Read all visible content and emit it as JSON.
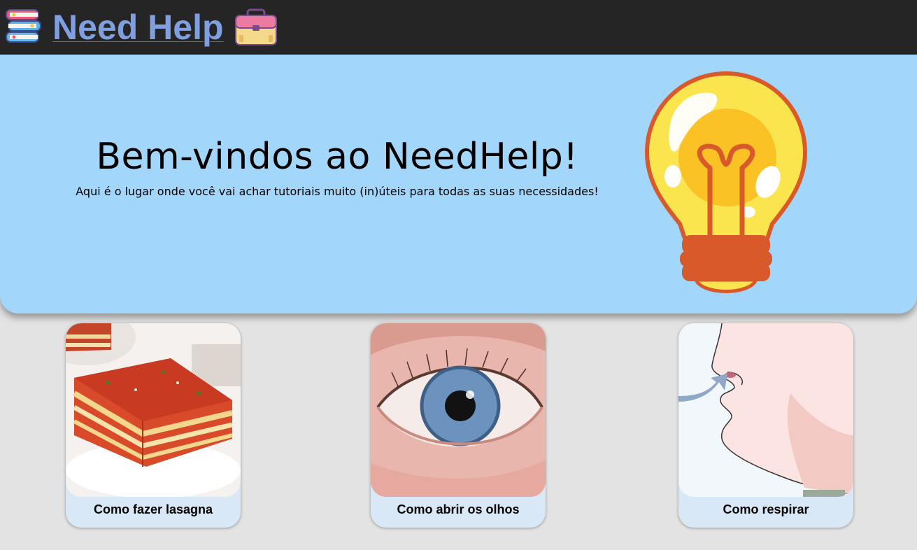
{
  "header": {
    "title": "Need Help",
    "left_icon": "books-icon",
    "right_icon": "toolbox-icon"
  },
  "hero": {
    "title": "Bem-vindos ao NeedHelp!",
    "subtitle": "Aqui é o lugar onde você vai achar tutoriais muito (in)úteis para todas as suas necessidades!",
    "illustration": "lightbulb-icon"
  },
  "cards": [
    {
      "label": "Como fazer lasagna",
      "image": "lasagna-image"
    },
    {
      "label": "Como abrir os olhos",
      "image": "eye-image"
    },
    {
      "label": "Como respirar",
      "image": "breathing-nose-image"
    }
  ],
  "colors": {
    "topbar": "#262525",
    "brand": "#7f9fe0",
    "hero_bg": "#a2d6fb",
    "page_bg": "#e3e3e3",
    "card_bg": "#d8e8f6"
  }
}
